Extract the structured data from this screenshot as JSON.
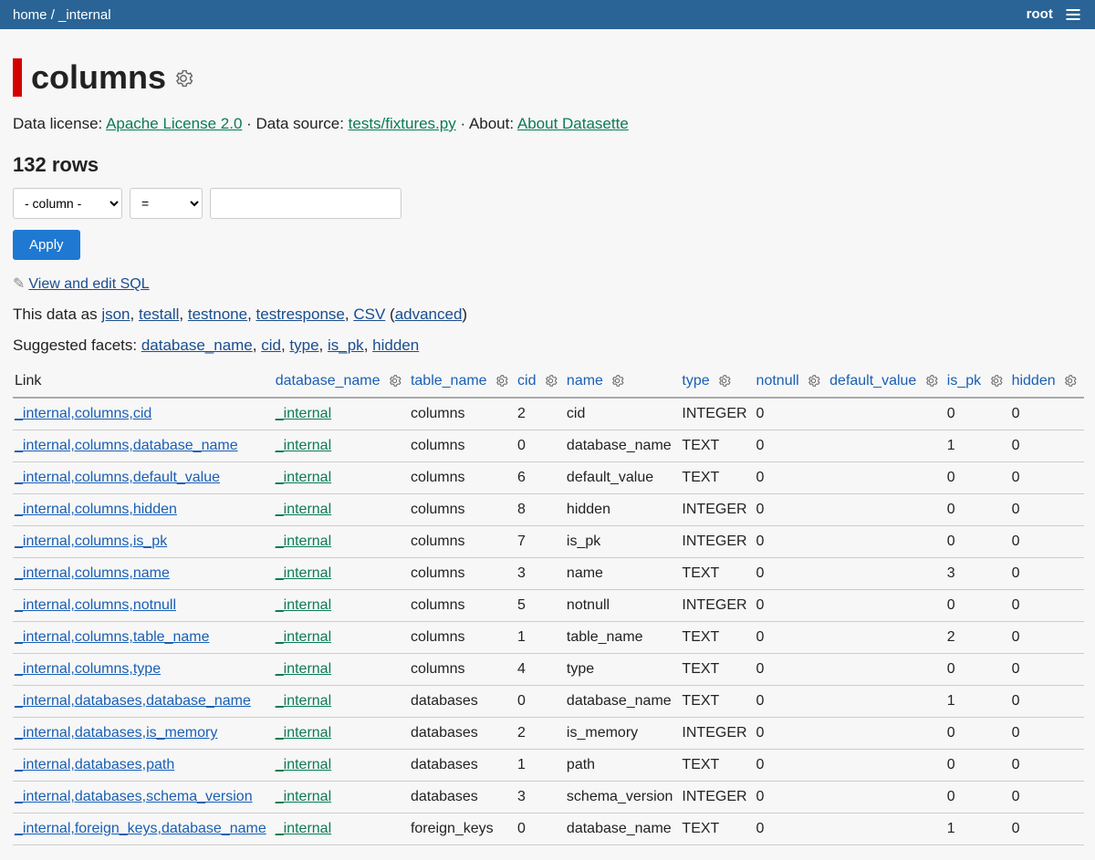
{
  "header": {
    "crumbs": [
      "home",
      "_internal"
    ],
    "user": "root"
  },
  "title": "columns",
  "meta": {
    "license_label": "Data license: ",
    "license_link": "Apache License 2.0",
    "source_label": "Data source: ",
    "source_link": "tests/fixtures.py",
    "about_label": "About: ",
    "about_link": "About Datasette"
  },
  "rowcount": "132 rows",
  "filter": {
    "column_placeholder": "- column -",
    "op_placeholder": "=",
    "apply": "Apply"
  },
  "sql_link": "View and edit SQL",
  "formats": {
    "prefix": "This data as ",
    "items": [
      "json",
      "testall",
      "testnone",
      "testresponse",
      "CSV"
    ],
    "advanced": "advanced"
  },
  "facets": {
    "prefix": "Suggested facets: ",
    "items": [
      "database_name",
      "cid",
      "type",
      "is_pk",
      "hidden"
    ]
  },
  "columns": [
    "Link",
    "database_name",
    "table_name",
    "cid",
    "name",
    "type",
    "notnull",
    "default_value",
    "is_pk",
    "hidden"
  ],
  "rows": [
    {
      "link": "_internal,columns,cid",
      "database_name": "_internal",
      "table_name": "columns",
      "cid": "2",
      "name": "cid",
      "type": "INTEGER",
      "notnull": "0",
      "default_value": "",
      "is_pk": "0",
      "hidden": "0"
    },
    {
      "link": "_internal,columns,database_name",
      "database_name": "_internal",
      "table_name": "columns",
      "cid": "0",
      "name": "database_name",
      "type": "TEXT",
      "notnull": "0",
      "default_value": "",
      "is_pk": "1",
      "hidden": "0"
    },
    {
      "link": "_internal,columns,default_value",
      "database_name": "_internal",
      "table_name": "columns",
      "cid": "6",
      "name": "default_value",
      "type": "TEXT",
      "notnull": "0",
      "default_value": "",
      "is_pk": "0",
      "hidden": "0"
    },
    {
      "link": "_internal,columns,hidden",
      "database_name": "_internal",
      "table_name": "columns",
      "cid": "8",
      "name": "hidden",
      "type": "INTEGER",
      "notnull": "0",
      "default_value": "",
      "is_pk": "0",
      "hidden": "0"
    },
    {
      "link": "_internal,columns,is_pk",
      "database_name": "_internal",
      "table_name": "columns",
      "cid": "7",
      "name": "is_pk",
      "type": "INTEGER",
      "notnull": "0",
      "default_value": "",
      "is_pk": "0",
      "hidden": "0"
    },
    {
      "link": "_internal,columns,name",
      "database_name": "_internal",
      "table_name": "columns",
      "cid": "3",
      "name": "name",
      "type": "TEXT",
      "notnull": "0",
      "default_value": "",
      "is_pk": "3",
      "hidden": "0"
    },
    {
      "link": "_internal,columns,notnull",
      "database_name": "_internal",
      "table_name": "columns",
      "cid": "5",
      "name": "notnull",
      "type": "INTEGER",
      "notnull": "0",
      "default_value": "",
      "is_pk": "0",
      "hidden": "0"
    },
    {
      "link": "_internal,columns,table_name",
      "database_name": "_internal",
      "table_name": "columns",
      "cid": "1",
      "name": "table_name",
      "type": "TEXT",
      "notnull": "0",
      "default_value": "",
      "is_pk": "2",
      "hidden": "0"
    },
    {
      "link": "_internal,columns,type",
      "database_name": "_internal",
      "table_name": "columns",
      "cid": "4",
      "name": "type",
      "type": "TEXT",
      "notnull": "0",
      "default_value": "",
      "is_pk": "0",
      "hidden": "0"
    },
    {
      "link": "_internal,databases,database_name",
      "database_name": "_internal",
      "table_name": "databases",
      "cid": "0",
      "name": "database_name",
      "type": "TEXT",
      "notnull": "0",
      "default_value": "",
      "is_pk": "1",
      "hidden": "0"
    },
    {
      "link": "_internal,databases,is_memory",
      "database_name": "_internal",
      "table_name": "databases",
      "cid": "2",
      "name": "is_memory",
      "type": "INTEGER",
      "notnull": "0",
      "default_value": "",
      "is_pk": "0",
      "hidden": "0"
    },
    {
      "link": "_internal,databases,path",
      "database_name": "_internal",
      "table_name": "databases",
      "cid": "1",
      "name": "path",
      "type": "TEXT",
      "notnull": "0",
      "default_value": "",
      "is_pk": "0",
      "hidden": "0"
    },
    {
      "link": "_internal,databases,schema_version",
      "database_name": "_internal",
      "table_name": "databases",
      "cid": "3",
      "name": "schema_version",
      "type": "INTEGER",
      "notnull": "0",
      "default_value": "",
      "is_pk": "0",
      "hidden": "0"
    },
    {
      "link": "_internal,foreign_keys,database_name",
      "database_name": "_internal",
      "table_name": "foreign_keys",
      "cid": "0",
      "name": "database_name",
      "type": "TEXT",
      "notnull": "0",
      "default_value": "",
      "is_pk": "1",
      "hidden": "0"
    }
  ]
}
